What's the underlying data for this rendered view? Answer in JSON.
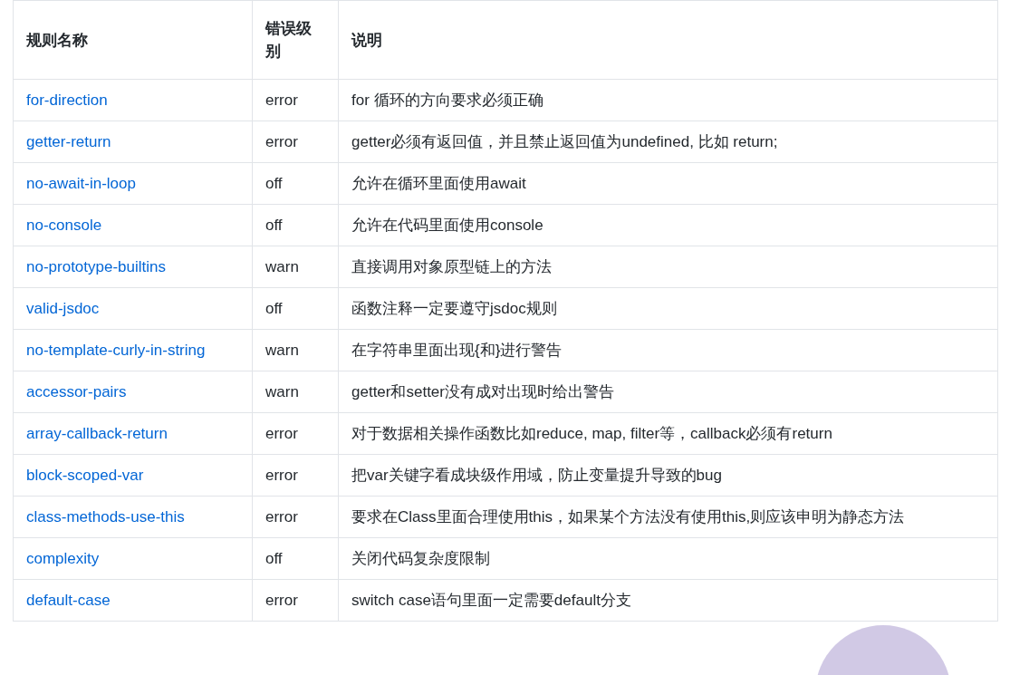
{
  "table": {
    "columns": [
      "规则名称",
      "错误级别",
      "说明"
    ],
    "rows": [
      {
        "name": "for-direction",
        "level": "error",
        "description": "for 循环的方向要求必须正确"
      },
      {
        "name": "getter-return",
        "level": "error",
        "description": "getter必须有返回值，并且禁止返回值为undefined, 比如 return;"
      },
      {
        "name": "no-await-in-loop",
        "level": "off",
        "description": "允许在循环里面使用await"
      },
      {
        "name": "no-console",
        "level": "off",
        "description": "允许在代码里面使用console"
      },
      {
        "name": "no-prototype-builtins",
        "level": "warn",
        "description": "直接调用对象原型链上的方法"
      },
      {
        "name": "valid-jsdoc",
        "level": "off",
        "description": "函数注释一定要遵守jsdoc规则"
      },
      {
        "name": "no-template-curly-in-string",
        "level": "warn",
        "description": "在字符串里面出现{和}进行警告"
      },
      {
        "name": "accessor-pairs",
        "level": "warn",
        "description": "getter和setter没有成对出现时给出警告"
      },
      {
        "name": "array-callback-return",
        "level": "error",
        "description": "对于数据相关操作函数比如reduce, map, filter等，callback必须有return"
      },
      {
        "name": "block-scoped-var",
        "level": "error",
        "description": "把var关键字看成块级作用域，防止变量提升导致的bug"
      },
      {
        "name": "class-methods-use-this",
        "level": "error",
        "description": "要求在Class里面合理使用this，如果某个方法没有使用this,则应该申明为静态方法"
      },
      {
        "name": "complexity",
        "level": "off",
        "description": "关闭代码复杂度限制"
      },
      {
        "name": "default-case",
        "level": "error",
        "description": "switch case语句里面一定需要default分支"
      }
    ]
  }
}
